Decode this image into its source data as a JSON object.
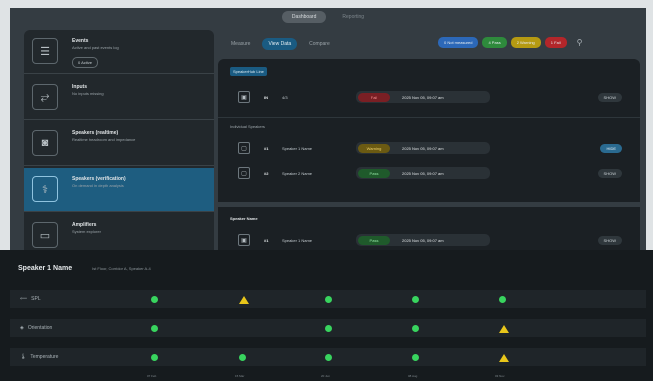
{
  "top_tabs": [
    "Dashboard",
    "Reporting"
  ],
  "sidebar": {
    "items": [
      {
        "title": "Events",
        "subtitle": "Active and past events log",
        "badge": "0 Active",
        "icon": "list-icon"
      },
      {
        "title": "Inputs",
        "subtitle": "No inputs missing",
        "icon": "input-icon"
      },
      {
        "title": "Speakers (realtime)",
        "subtitle": "Realtime headroom and impedance",
        "icon": "speaker-icon"
      },
      {
        "title": "Speakers (verification)",
        "subtitle": "On demand in depth analysis",
        "icon": "stethoscope-icon"
      },
      {
        "title": "Amplifiers",
        "subtitle": "System explorer",
        "icon": "amplifier-icon"
      }
    ]
  },
  "view_tabs": [
    "Measure",
    "View Data",
    "Compare"
  ],
  "filters": [
    {
      "label": "0 Not measured",
      "color": "#2c68b8"
    },
    {
      "label": "4 Pass",
      "color": "#2e8a3c"
    },
    {
      "label": "2 Warning",
      "color": "#b59a12"
    },
    {
      "label": "1 Fail",
      "color": "#b3262a"
    }
  ],
  "main": {
    "section_speakerhub": "SpeakerHub Line",
    "row_hub": {
      "num": "IN",
      "name": "4/3",
      "status": "Fail",
      "date": "2025 Nov 05, 09:07 am",
      "button": "SHOW"
    },
    "section_individual": "Individual Speakers",
    "rows_individual": [
      {
        "num": "#1",
        "name": "Speaker 1 Name",
        "status": "Warning",
        "date": "2025 Nov 05, 09:07 am",
        "button": "HIDE"
      },
      {
        "num": "#2",
        "name": "Speaker 2 Name",
        "status": "Pass",
        "date": "2025 Nov 05, 09:07 am",
        "button": "SHOW"
      }
    ],
    "section_speaker_name": "Speaker Name",
    "row_speaker_name": {
      "num": "#1",
      "name": "Speaker 1 Name",
      "status": "Pass",
      "date": "2025 Nov 05, 09:07 am",
      "button": "SHOW"
    }
  },
  "status_colors": {
    "Fail": "#7a1f24",
    "Warning": "#6b5a12",
    "Pass": "#1f5a2b"
  },
  "status_text_colors": {
    "Fail": "#f08a8c",
    "Warning": "#f0d36a",
    "Pass": "#8fe0a0"
  },
  "bottom": {
    "speaker_name": "Speaker 1 Name",
    "location": "Ist Floor, Corridor A, Speaker A-4",
    "metrics": [
      {
        "label": "SPL",
        "icon": "spl-icon",
        "marks": [
          "ok",
          "warn",
          "ok",
          "ok",
          "ok"
        ]
      },
      {
        "label": "Orientation",
        "icon": "orientation-icon",
        "marks": [
          "ok",
          "",
          "ok",
          "ok",
          "warn"
        ]
      },
      {
        "label": "Temperature",
        "icon": "thermometer-icon",
        "marks": [
          "ok",
          "ok",
          "ok",
          "ok",
          "warn"
        ]
      }
    ],
    "x_ticks": [
      "07 Feb",
      "15 Mar",
      "20 Jun",
      "08 Aug",
      "03 Nov"
    ]
  }
}
